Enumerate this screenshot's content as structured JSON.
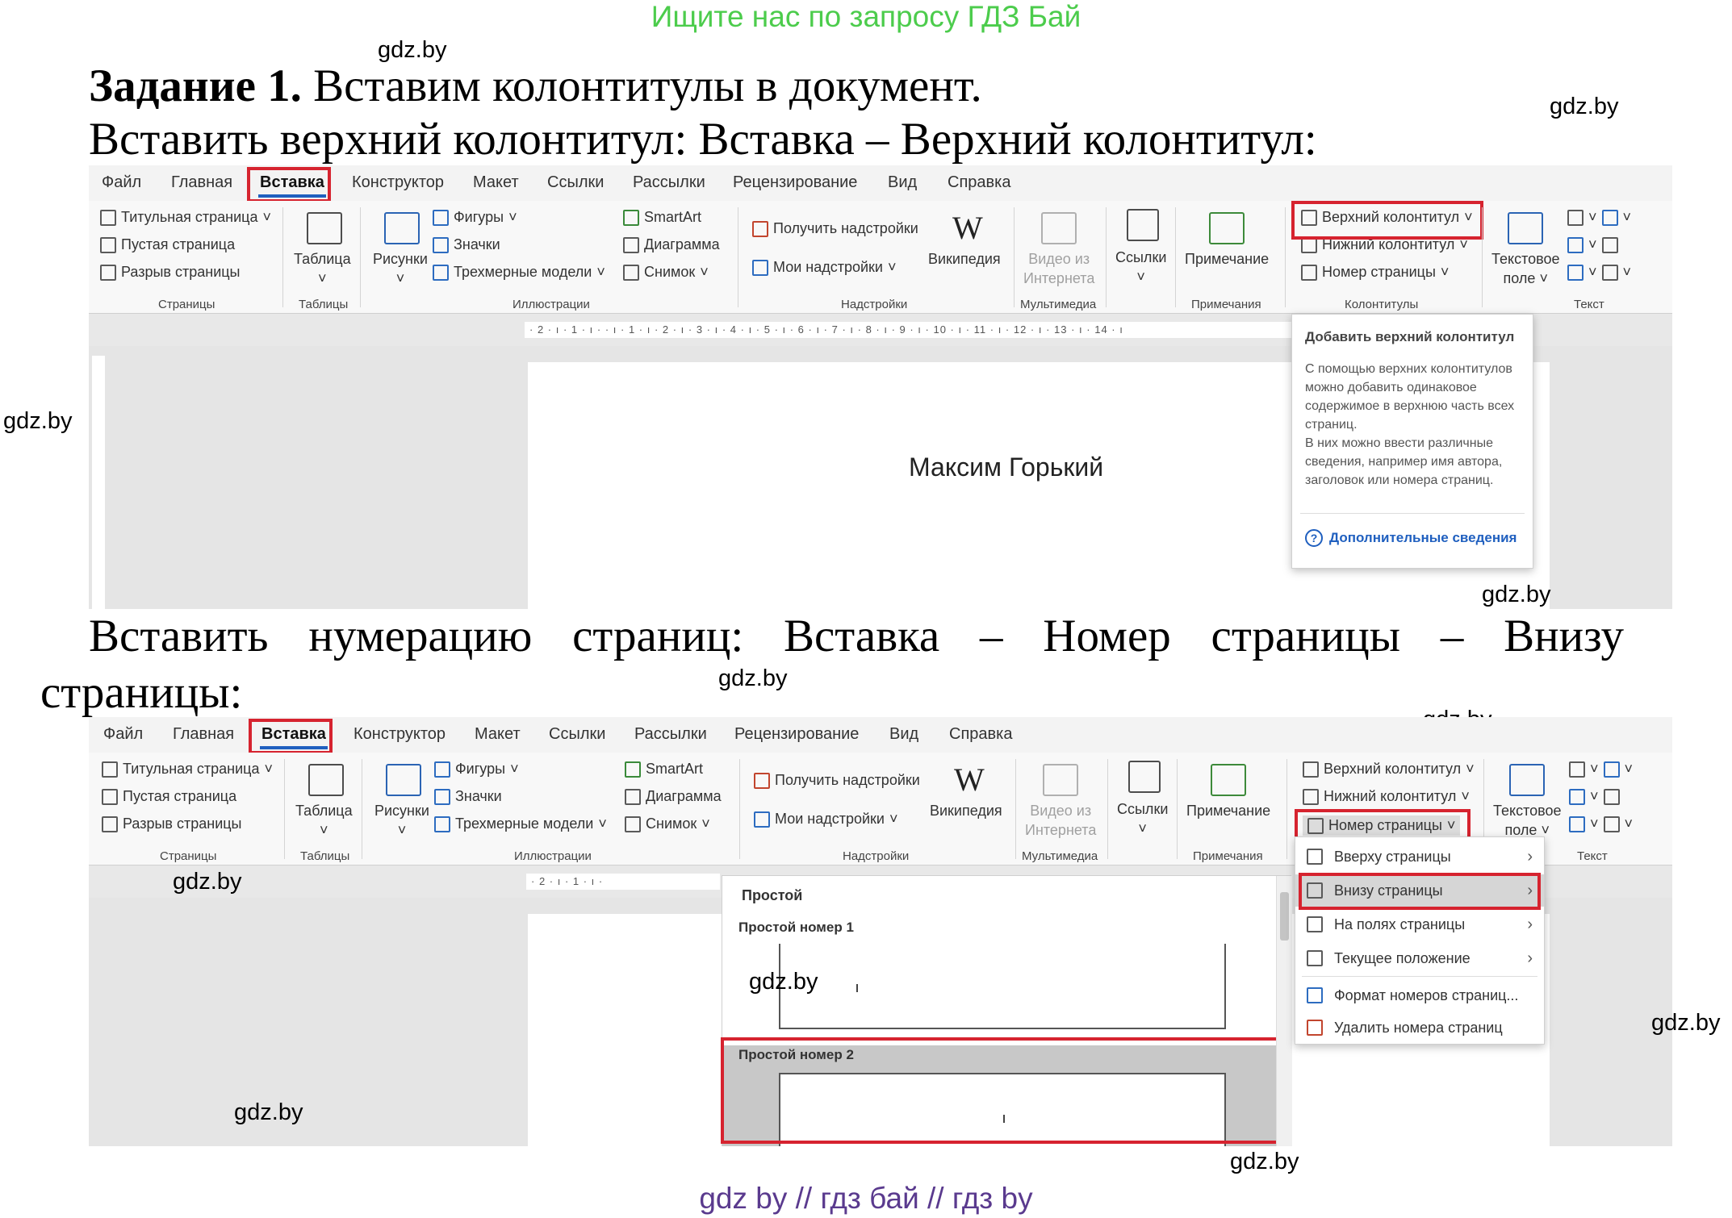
{
  "banner": "Ищите нас по запросу ГДЗ Бай",
  "watermark": "gdz.by",
  "task": {
    "label": "Задание 1.",
    "text": "Вставим колонтитулы в документ.",
    "line2": "Вставить верхний колонтитул: Вставка – Верхний колонтитул:",
    "line3_words": [
      "Вставить",
      "нумерацию",
      "страниц:",
      "Вставка",
      "–",
      "Номер",
      "страницы",
      "–",
      "Внизу"
    ],
    "line4": "страницы:"
  },
  "ribbon": {
    "tabs": [
      "Файл",
      "Главная",
      "Вставка",
      "Конструктор",
      "Макет",
      "Ссылки",
      "Рассылки",
      "Рецензирование",
      "Вид",
      "Справка"
    ],
    "pages": [
      "Титульная страница",
      "Пустая страница",
      "Разрыв страницы"
    ],
    "table": "Таблица",
    "pictures": "Рисунки",
    "shapes": "Фигуры",
    "icons": "Значки",
    "models": "Трехмерные модели",
    "smartart": "SmartArt",
    "chart": "Диаграмма",
    "screenshot": "Снимок",
    "get_addins": "Получить надстройки",
    "my_addins": "Мои надстройки",
    "wikipedia": "Википедия",
    "video1": "Видео из",
    "video2": "Интернета",
    "links": "Ссылки",
    "comment": "Примечание",
    "header": "Верхний колонтитул",
    "footer": "Нижний колонтитул",
    "pagenum": "Номер страницы",
    "textbox1": "Текстовое",
    "textbox2": "поле",
    "groups": {
      "pages": "Страницы",
      "tables": "Таблицы",
      "illustrations": "Иллюстрации",
      "addins": "Надстройки",
      "media": "Мультимедиа",
      "comments": "Примечания",
      "headers": "Колонтитулы",
      "text": "Текст"
    }
  },
  "ruler": {
    "h1": "· 2 · ı · 1 · ı ·   · ı · 1 · ı · 2 · ı · 3 · ı · 4 · ı · 5 · ı · 6 · ı · 7 · ı · 8 · ı · 9 · ı · 10 · ı · 11 · ı · 12 · ı · 13 · ı · 14 · ı",
    "h2": "· 2 · ı · 1 · ı ·"
  },
  "doc_text": "Максим Горький",
  "tooltip": {
    "title": "Добавить верхний колонтитул",
    "p1": "С помощью верхних колонтитулов можно добавить одинаковое содержимое в верхнюю часть всех страниц.",
    "p2": "В них можно ввести различные сведения, например имя автора, заголовок или номера страниц.",
    "link": "Дополнительные сведения"
  },
  "menu": {
    "items": [
      "Вверху страницы",
      "Внизу страницы",
      "На полях страницы",
      "Текущее положение",
      "Формат номеров страниц...",
      "Удалить номера страниц"
    ]
  },
  "gallery": {
    "section": "Простой",
    "item1": "Простой номер 1",
    "item2": "Простой номер 2"
  },
  "footer": "gdz by  //  гдз бай  //  гдз by"
}
